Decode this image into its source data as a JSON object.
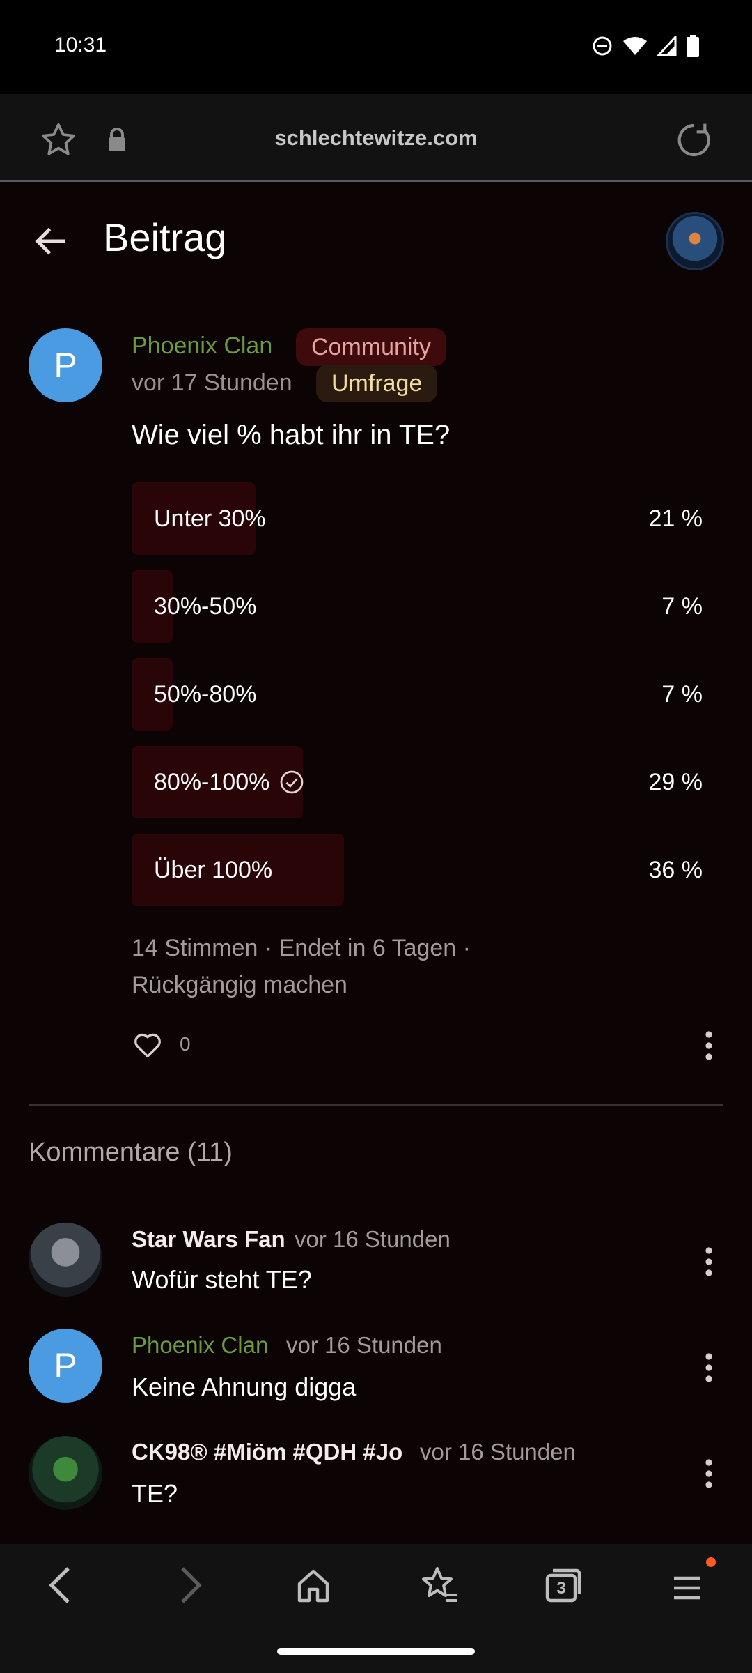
{
  "status_bar": {
    "time": "10:31"
  },
  "browser": {
    "url": "schlechtewitze.com"
  },
  "header": {
    "title": "Beitrag"
  },
  "post": {
    "author_initial": "P",
    "author": "Phoenix Clan",
    "badge_community": "Community",
    "time": "vor 17 Stunden",
    "badge_type": "Umfrage",
    "question": "Wie viel % habt ihr in TE?",
    "poll": [
      {
        "label": "Unter 30%",
        "percent_text": "21 %",
        "percent": 21,
        "selected": false
      },
      {
        "label": "30%-50%",
        "percent_text": "7 %",
        "percent": 7,
        "selected": false
      },
      {
        "label": "50%-80%",
        "percent_text": "7 %",
        "percent": 7,
        "selected": false
      },
      {
        "label": "80%-100%",
        "percent_text": "29 %",
        "percent": 29,
        "selected": true
      },
      {
        "label": "Über 100%",
        "percent_text": "36 %",
        "percent": 36,
        "selected": false
      }
    ],
    "meta": "14 Stimmen · Endet in 6 Tagen ·",
    "undo": "Rückgängig machen",
    "likes": "0"
  },
  "comments": {
    "heading": "Kommentare (11)",
    "items": [
      {
        "author": "Star Wars Fan",
        "time": "vor 16 Stunden",
        "text": "Wofür steht TE?"
      },
      {
        "author": "Phoenix Clan",
        "avatar_initial": "P",
        "time": "vor 16 Stunden",
        "text": "Keine Ahnung digga"
      },
      {
        "author": "CK98® #Miöm #QDH #Jo",
        "time": "vor 16 Stunden",
        "text": "TE?"
      }
    ]
  },
  "bottom_nav": {
    "tabs_count": "3"
  },
  "colors": {
    "accent_green": "#6a9b3e",
    "avatar_blue": "#4a9be2",
    "poll_fill": "#2a0508",
    "notification_dot": "#ff5a1f"
  }
}
